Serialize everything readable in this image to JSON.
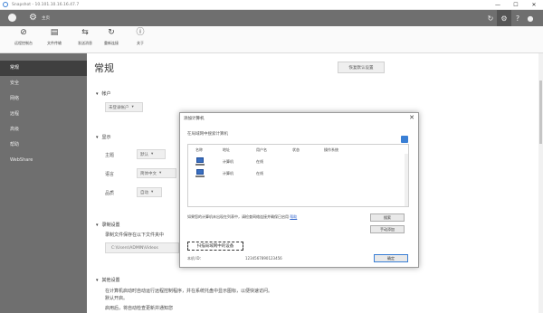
{
  "window": {
    "title": "Snapshot - 10.101.10.16.16.47.7",
    "minimize": "—",
    "maximize": "☐",
    "close": "✕"
  },
  "topbar": {
    "home_label": "主页"
  },
  "ribbon": {
    "buttons": [
      {
        "label": "远程控制台",
        "icon": "disconnect-icon"
      },
      {
        "label": "文件传输",
        "icon": "file-transfer-icon"
      },
      {
        "label": "发送消息",
        "icon": "send-message-icon"
      },
      {
        "label": "重新连接",
        "icon": "reconnect-icon"
      },
      {
        "label": "关于",
        "icon": "info-icon"
      }
    ]
  },
  "sidebar": {
    "items": [
      {
        "label": "常规",
        "active": true
      },
      {
        "label": "安全",
        "active": false
      },
      {
        "label": "网络",
        "active": false
      },
      {
        "label": "远程",
        "active": false
      },
      {
        "label": "高级",
        "active": false
      },
      {
        "label": "帮助",
        "active": false
      },
      {
        "label": "WebShare",
        "active": false
      }
    ]
  },
  "main": {
    "title": "常规",
    "restore_button": "恢复默认设置",
    "section_account": "帐户",
    "account_dropdown": "未登录帐户",
    "section_display": "显示",
    "display_rows": [
      {
        "label": "主题",
        "value": "默认"
      },
      {
        "label": "语言",
        "value": "简体中文"
      },
      {
        "label": "品质",
        "value": "自动"
      }
    ],
    "section_record": "录制设置",
    "record_desc": "录制文件保存在以下文件夹中",
    "record_path": "C:\\Users\\ADMIN\\Videos",
    "section_other": "其他设置",
    "other_line1": "在计算机启动时自动运行远程控制程序，并在系统托盘中显示图标，以便快速访问。",
    "other_line2": "默认开启。",
    "other_line3": "启用后，将自动检查更新并通知您"
  },
  "dialog": {
    "title": "添加计算机",
    "subtitle": "在局域网中搜索计算机",
    "columns": [
      "名称",
      "地址",
      "用户名",
      "状态",
      "操作系统"
    ],
    "rows": [
      {
        "name": "计算机",
        "status": "在线"
      },
      {
        "name": "计算机",
        "status": "在线"
      }
    ],
    "note_text": "如果您的计算机未出现在列表中，请检查网络连接并确保已启用",
    "note_link": "帮助",
    "button_search": "搜索",
    "button_manual": "手动添加",
    "button_ok": "确定",
    "dotted_label": "扫描局域网中的设备",
    "id_label": "本机 ID：",
    "id_value": "1234567890123456"
  }
}
